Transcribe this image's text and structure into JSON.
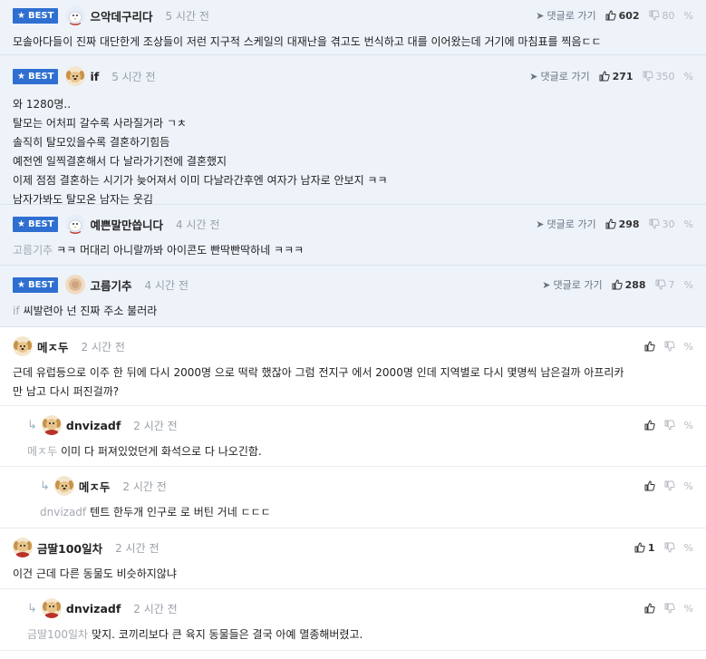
{
  "labels": {
    "best": "BEST",
    "goto_reply": "댓글로 가기"
  },
  "comments": [
    {
      "best": true,
      "depth": 0,
      "avatar": "bird-avatar",
      "nick": "으악데구리다",
      "time": "5 시간 전",
      "likes": "602",
      "dislikes": "80",
      "mention": "",
      "lines": [
        "모솔아다들이 진짜 대단한게 조상들이 저런 지구적 스케일의 대재난을 겪고도 번식하고 대를 이어왔는데 거기에 마침표를 찍음ㄷㄷ"
      ]
    },
    {
      "best": true,
      "depth": 0,
      "avatar": "dog-avatar",
      "nick": "if",
      "time": "5 시간 전",
      "likes": "271",
      "dislikes": "350",
      "mention": "",
      "lines": [
        "와 1280명..",
        "탈모는 어처피 갈수록 사라질거라 ㄱㅊ",
        "솔직히 탈모있을수록 결혼하기힘듬",
        "예전엔 일찍결혼해서 다 날라가기전에 결혼했지",
        "이제 점점 결혼하는 시기가 늦어져서 이미 다날라간후엔 여자가 남자로 안보지 ㅋㅋ",
        "남자가봐도 탈모온 남자는 웃김"
      ]
    },
    {
      "best": true,
      "depth": 0,
      "avatar": "bird-avatar",
      "nick": "예쁜말만씁니다",
      "time": "4 시간 전",
      "likes": "298",
      "dislikes": "30",
      "mention": "고름기추",
      "lines": [
        "ㅋㅋ 머대리 아니랄까봐 아이콘도 빤딱빤딱하네 ㅋㅋㅋ"
      ]
    },
    {
      "best": true,
      "depth": 0,
      "avatar": "blur-avatar",
      "nick": "고름기추",
      "time": "4 시간 전",
      "likes": "288",
      "dislikes": "7",
      "mention": "if",
      "lines": [
        "씨발련아 넌 진짜 주소 불러라"
      ]
    },
    {
      "best": false,
      "depth": 0,
      "avatar": "dog-avatar",
      "nick": "메ㅈ두",
      "time": "2 시간 전",
      "likes": "",
      "dislikes": "",
      "mention": "",
      "lines": [
        "근데 유럽등으로 이주 한 뒤에 다시 2000명 으로 떡락 했잖아 그럼 전지구 에서 2000명 인데 지역별로 다시 몇명씩 남은걸까 아프리카",
        "만 남고 다시 퍼진걸까?"
      ]
    },
    {
      "best": false,
      "depth": 1,
      "avatar": "dog-red-avatar",
      "nick": "dnvizadf",
      "time": "2 시간 전",
      "likes": "",
      "dislikes": "",
      "mention": "메ㅈ두",
      "lines": [
        "이미 다 퍼져있었던게 화석으로 다 나오긴함."
      ]
    },
    {
      "best": false,
      "depth": 2,
      "avatar": "dog-avatar",
      "nick": "메ㅈ두",
      "time": "2 시간 전",
      "likes": "",
      "dislikes": "",
      "mention": "dnvizadf",
      "lines": [
        "텐트 한두개 인구로 로 버틴 거네 ㄷㄷㄷ"
      ]
    },
    {
      "best": false,
      "depth": 0,
      "avatar": "dog-red-avatar",
      "nick": "금딸100일차",
      "time": "2 시간 전",
      "likes": "1",
      "dislikes": "",
      "mention": "",
      "lines": [
        "이건 근데 다른 동물도 비슷하지않냐"
      ]
    },
    {
      "best": false,
      "depth": 1,
      "avatar": "dog-red-avatar",
      "nick": "dnvizadf",
      "time": "2 시간 전",
      "likes": "",
      "dislikes": "",
      "mention": "금딸100일차",
      "lines": [
        "맞지. 코끼리보다 큰 육지 동물들은 결국 아예 멸종해버렸고."
      ]
    }
  ]
}
